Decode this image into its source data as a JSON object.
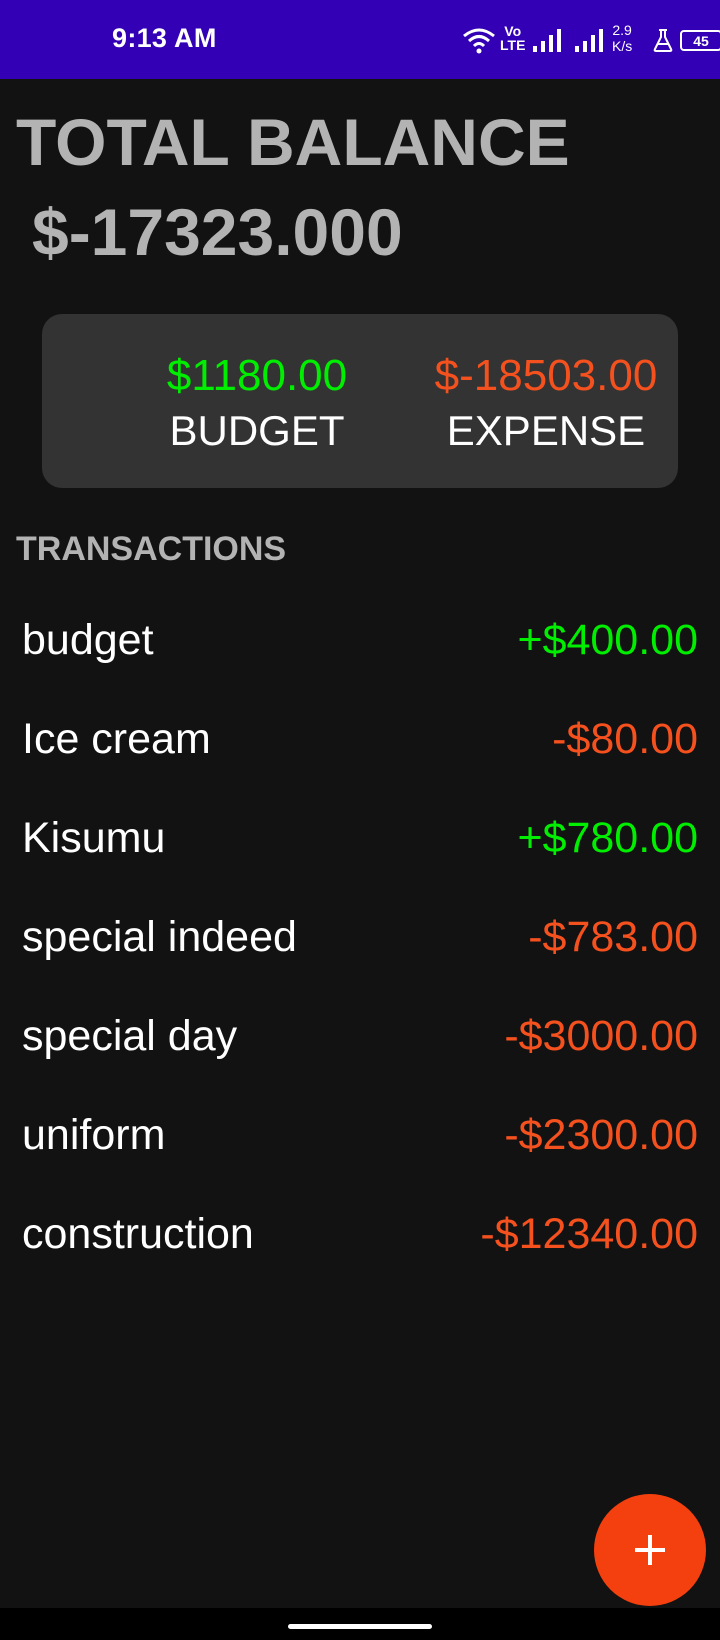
{
  "status_bar": {
    "time": "9:13 AM",
    "volte_top": "Vo",
    "volte_bottom": "LTE",
    "net_speed_value": "2.9",
    "net_speed_unit": "K/s",
    "battery_level": "45",
    "background_color": "#3300B5"
  },
  "header": {
    "title": "TOTAL BALANCE",
    "balance": "$-17323.000"
  },
  "summary": {
    "budget_value": "$1180.00",
    "budget_label": "BUDGET",
    "expense_value": "$-18503.00",
    "expense_label": "EXPENSE"
  },
  "transactions": {
    "title": "TRANSACTIONS",
    "items": [
      {
        "name": "budget",
        "amount": "+$400.00",
        "type": "income"
      },
      {
        "name": "Ice cream",
        "amount": "-$80.00",
        "type": "expense"
      },
      {
        "name": "Kisumu",
        "amount": "+$780.00",
        "type": "income"
      },
      {
        "name": "special indeed",
        "amount": "-$783.00",
        "type": "expense"
      },
      {
        "name": "special day",
        "amount": "-$3000.00",
        "type": "expense"
      },
      {
        "name": "uniform",
        "amount": "-$2300.00",
        "type": "expense"
      },
      {
        "name": "construction",
        "amount": "-$12340.00",
        "type": "expense"
      }
    ]
  },
  "fab": {
    "icon": "plus-icon",
    "color": "#F4400E"
  },
  "colors": {
    "income": "#00EE00",
    "expense": "#F4511E",
    "background": "#121212",
    "card": "#333333"
  }
}
